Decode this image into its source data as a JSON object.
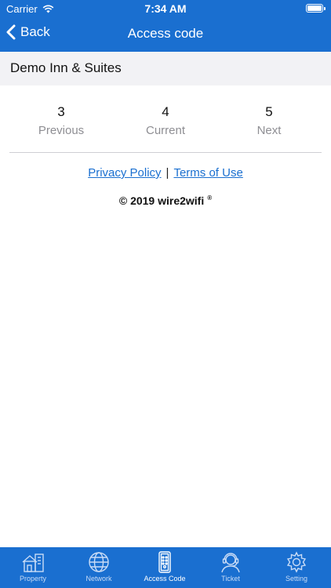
{
  "status_bar": {
    "carrier": "Carrier",
    "time": "7:34 AM"
  },
  "navbar": {
    "back_label": "Back",
    "title": "Access code"
  },
  "property": {
    "name": "Demo Inn & Suites"
  },
  "codes": [
    {
      "value": "3",
      "label": "Previous"
    },
    {
      "value": "4",
      "label": "Current"
    },
    {
      "value": "5",
      "label": "Next"
    }
  ],
  "footer": {
    "privacy": "Privacy Policy",
    "separator": "|",
    "terms": "Terms of Use",
    "copyright": "© 2019 wire2wifi",
    "registered": "®"
  },
  "tabs": [
    {
      "label": "Property",
      "icon": "property-icon"
    },
    {
      "label": "Network",
      "icon": "globe-icon"
    },
    {
      "label": "Access Code",
      "icon": "keypad-icon",
      "active": true
    },
    {
      "label": "Ticket",
      "icon": "support-agent-icon"
    },
    {
      "label": "Setting",
      "icon": "gear-icon"
    }
  ],
  "colors": {
    "primary": "#1a6fd0",
    "property_bar": "#f2f2f5",
    "link": "#1a6fd0"
  }
}
